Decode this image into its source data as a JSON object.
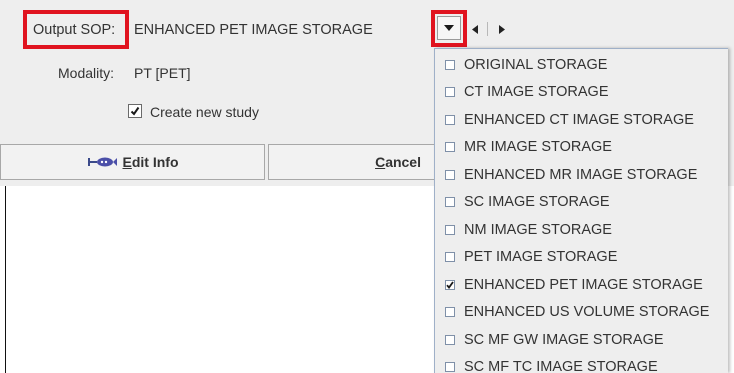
{
  "output_sop": {
    "label": "Output SOP:",
    "value": "ENHANCED PET IMAGE STORAGE"
  },
  "modality": {
    "label": "Modality:",
    "value": "PT [PET]"
  },
  "create_new_study": {
    "label": "Create new study",
    "checked": true
  },
  "buttons": {
    "edit_info": "Edit Info",
    "cancel": "Cancel"
  },
  "menu": {
    "items": [
      {
        "label": "ORIGINAL STORAGE",
        "checked": false
      },
      {
        "label": "CT IMAGE STORAGE",
        "checked": false
      },
      {
        "label": "ENHANCED CT IMAGE STORAGE",
        "checked": false
      },
      {
        "label": "MR IMAGE STORAGE",
        "checked": false
      },
      {
        "label": "ENHANCED MR IMAGE STORAGE",
        "checked": false
      },
      {
        "label": "SC IMAGE STORAGE",
        "checked": false
      },
      {
        "label": "NM IMAGE STORAGE",
        "checked": false
      },
      {
        "label": "PET IMAGE STORAGE",
        "checked": false
      },
      {
        "label": "ENHANCED PET IMAGE STORAGE",
        "checked": true
      },
      {
        "label": "ENHANCED US VOLUME STORAGE",
        "checked": false
      },
      {
        "label": "SC MF GW IMAGE STORAGE",
        "checked": false
      },
      {
        "label": "SC MF TC IMAGE STORAGE",
        "checked": false
      }
    ]
  },
  "colors": {
    "highlight": "#e0131f",
    "panel": "#eeeeee"
  }
}
